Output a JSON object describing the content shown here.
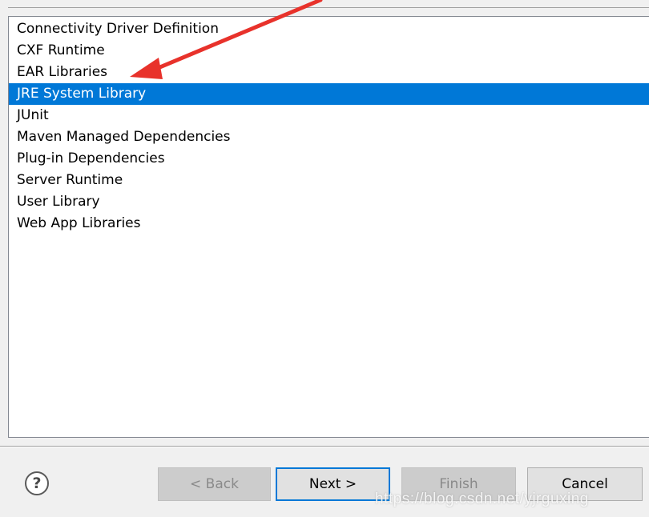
{
  "list": {
    "items": [
      {
        "label": "Connectivity Driver Definition",
        "selected": false
      },
      {
        "label": "CXF Runtime",
        "selected": false
      },
      {
        "label": "EAR Libraries",
        "selected": false
      },
      {
        "label": "JRE System Library",
        "selected": true
      },
      {
        "label": "JUnit",
        "selected": false
      },
      {
        "label": "Maven Managed Dependencies",
        "selected": false
      },
      {
        "label": "Plug-in Dependencies",
        "selected": false
      },
      {
        "label": "Server Runtime",
        "selected": false
      },
      {
        "label": "User Library",
        "selected": false
      },
      {
        "label": "Web App Libraries",
        "selected": false
      }
    ]
  },
  "footer": {
    "help_symbol": "?",
    "back_label": "< Back",
    "next_label": "Next >",
    "finish_label": "Finish",
    "cancel_label": "Cancel"
  },
  "watermark": "https://blog.csdn.net/yjrguxing",
  "colors": {
    "selection": "#0078d7",
    "arrow": "#e8322b"
  }
}
